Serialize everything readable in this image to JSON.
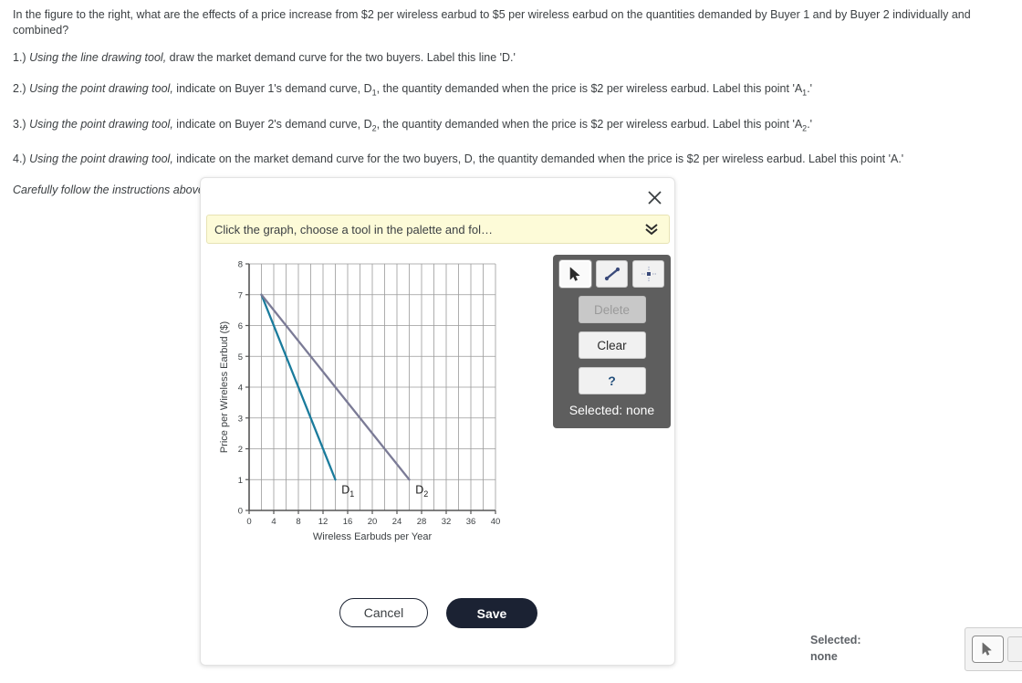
{
  "question": {
    "intro": "In the figure to the right, what are the effects of a price increase from $2 per wireless earbud to $5 per wireless earbud on the quantities demanded by Buyer 1 and by Buyer 2 individually and combined?",
    "steps": [
      {
        "num": "1.)",
        "tool": "Using the line drawing tool,",
        "rest": " draw the market demand curve for the two buyers. Label this line 'D.'",
        "sub": "",
        "after_sub": ""
      },
      {
        "num": "2.)",
        "tool": "Using the point drawing tool,",
        "rest": " indicate on Buyer 1's demand curve, D",
        "sub": "1",
        "after_sub": ", the quantity demanded when the price is $2 per wireless earbud. Label this point 'A",
        "sub2": "1",
        "tail": ".'"
      },
      {
        "num": "3.)",
        "tool": "Using the point drawing tool,",
        "rest": " indicate on Buyer 2's demand curve, D",
        "sub": "2",
        "after_sub": ", the quantity demanded when the price is $2 per wireless earbud. Label this point 'A",
        "sub2": "2",
        "tail": ".'"
      },
      {
        "num": "4.)",
        "tool": "Using the point drawing tool,",
        "rest": " indicate on the market demand curve for the two buyers, D, the quantity demanded when the price is $2 per wireless earbud. Label this point 'A.'",
        "sub": "",
        "after_sub": ""
      }
    ],
    "note": "Carefully follow the instructions above, and only draw the required objects."
  },
  "dialog": {
    "close_icon": "close-icon",
    "instruction": "Click the graph, choose a tool in the palette and fol…",
    "expand_icon": "chevron-double-down-icon",
    "cancel_label": "Cancel",
    "save_label": "Save"
  },
  "palette": {
    "tools": [
      {
        "name": "select-tool",
        "icon": "cursor-arrow-icon",
        "selected": true
      },
      {
        "name": "line-tool",
        "icon": "line-draw-icon",
        "selected": false
      },
      {
        "name": "point-tool",
        "icon": "point-draw-icon",
        "selected": false
      }
    ],
    "delete_label": "Delete",
    "delete_disabled": true,
    "clear_label": "Clear",
    "help_label": "?",
    "selected_label": "Selected: none"
  },
  "floating": {
    "selected_label": "Selected:",
    "selected_value": "none",
    "tool_icon": "cursor-arrow-icon"
  },
  "colors": {
    "d1_line": "#1a7b9c",
    "d2_line": "#7b7b96",
    "instruction_bg": "#fdfbd8",
    "palette_bg": "#5e5e5e",
    "save_bg": "#1b2233",
    "grid": "#9a9a9a",
    "axis": "#555555"
  },
  "chart_data": {
    "type": "line",
    "title": "",
    "xlabel": "Wireless Earbuds per Year",
    "ylabel": "Price per Wireless Earbud ($)",
    "xlim": [
      0,
      40
    ],
    "ylim": [
      0,
      8
    ],
    "xticks": [
      0,
      4,
      8,
      12,
      16,
      20,
      24,
      28,
      32,
      36,
      40
    ],
    "yticks": [
      0,
      1,
      2,
      3,
      4,
      5,
      6,
      7,
      8
    ],
    "x_minor_step": 2,
    "y_minor_step": 1,
    "grid": true,
    "legend": "none",
    "series": [
      {
        "name": "D1",
        "label": "D",
        "label_sub": "1",
        "color": "#1a7b9c",
        "points": [
          [
            2,
            7
          ],
          [
            14,
            1
          ]
        ],
        "label_pos": [
          15.0,
          0.55
        ]
      },
      {
        "name": "D2",
        "label": "D",
        "label_sub": "2",
        "color": "#7b7b96",
        "points": [
          [
            2,
            7
          ],
          [
            26,
            1
          ]
        ],
        "label_pos": [
          27.0,
          0.55
        ]
      }
    ]
  }
}
